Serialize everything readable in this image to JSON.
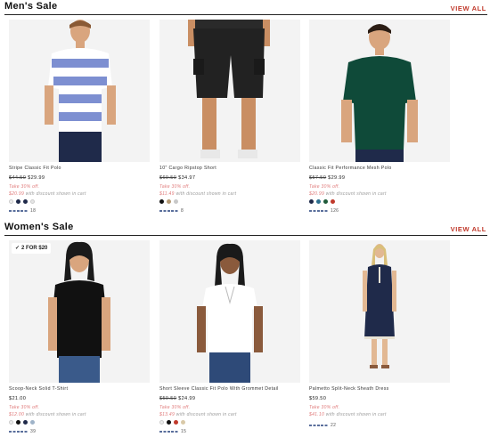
{
  "mens": {
    "title": "Men's Sale",
    "view_all": "VIEW ALL",
    "products": [
      {
        "name": "Stripe Classic Fit Polo",
        "old_price": "$44.50",
        "new_price": "$29.99",
        "save": "Take 30% off.",
        "cart_price": "$20.99",
        "cart_text": "with discount shown in cart",
        "swatches": [
          "#eeeeee",
          "#1f2a4a",
          "#1f2a4a",
          "#e6e6e6"
        ],
        "reviews": "18"
      },
      {
        "name": "10\" Cargo Ripstop Short",
        "old_price": "$69.50",
        "new_price": "$34.97",
        "save": "Take 30% off.",
        "cart_price": "$11.49",
        "cart_text": "with discount shown in cart",
        "swatches": [
          "#111111",
          "#b69b76",
          "#c8c8c8"
        ],
        "reviews": "8"
      },
      {
        "name": "Classic Fit Performance Mesh Polo",
        "old_price": "$57.50",
        "new_price": "$29.99",
        "save": "Take 30% off.",
        "cart_price": "$20.99",
        "cart_text": "with discount shown in cart",
        "swatches": [
          "#1f2a4a",
          "#2d6f8f",
          "#1f5b3a",
          "#c0392b"
        ],
        "reviews": "126"
      }
    ]
  },
  "womens": {
    "title": "Women's Sale",
    "view_all": "VIEW ALL",
    "products": [
      {
        "badge": "2 FOR $20",
        "name": "Scoop-Neck Solid T-Shirt",
        "old_price": "",
        "new_price": "$21.00",
        "save": "Take 30% off.",
        "cart_price": "$12.00",
        "cart_text": "with discount shown in cart",
        "swatches": [
          "#eeeeee",
          "#111111",
          "#1f2a4a",
          "#9fb3c8"
        ],
        "reviews": "39"
      },
      {
        "badge": "",
        "name": "Short Sleeve Classic Fit Polo With Grommet Detail",
        "old_price": "$59.50",
        "new_price": "$24.99",
        "save": "Take 30% off.",
        "cart_price": "$13.49",
        "cart_text": "with discount shown in cart",
        "swatches": [
          "#eeeeee",
          "#111111",
          "#c0392b",
          "#d9c9a8"
        ],
        "reviews": "15"
      },
      {
        "badge": "",
        "name": "Palmetto Split-Neck Sheath Dress",
        "old_price": "",
        "new_price": "$59.50",
        "save": "Take 30% off.",
        "cart_price": "$41.10",
        "cart_text": "with discount shown in cart",
        "swatches": [],
        "reviews": "22"
      }
    ]
  },
  "colors": {
    "accent": "#c0392b",
    "sale_text": "#e07a7a",
    "star": "#5a6f9c"
  }
}
